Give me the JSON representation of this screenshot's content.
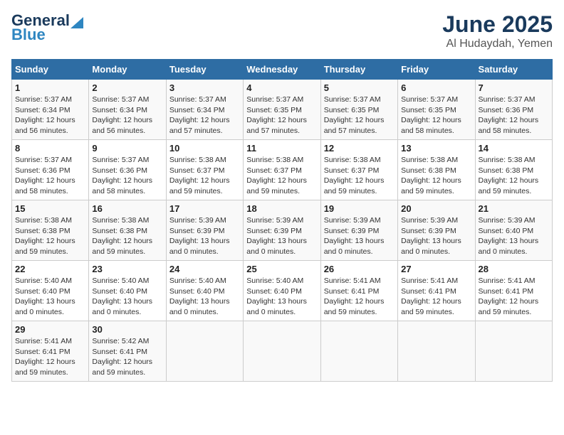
{
  "header": {
    "logo_line1": "General",
    "logo_line2": "Blue",
    "month_title": "June 2025",
    "location": "Al Hudaydah, Yemen"
  },
  "weekdays": [
    "Sunday",
    "Monday",
    "Tuesday",
    "Wednesday",
    "Thursday",
    "Friday",
    "Saturday"
  ],
  "weeks": [
    [
      {
        "day": "1",
        "info": "Sunrise: 5:37 AM\nSunset: 6:34 PM\nDaylight: 12 hours\nand 56 minutes."
      },
      {
        "day": "2",
        "info": "Sunrise: 5:37 AM\nSunset: 6:34 PM\nDaylight: 12 hours\nand 56 minutes."
      },
      {
        "day": "3",
        "info": "Sunrise: 5:37 AM\nSunset: 6:34 PM\nDaylight: 12 hours\nand 57 minutes."
      },
      {
        "day": "4",
        "info": "Sunrise: 5:37 AM\nSunset: 6:35 PM\nDaylight: 12 hours\nand 57 minutes."
      },
      {
        "day": "5",
        "info": "Sunrise: 5:37 AM\nSunset: 6:35 PM\nDaylight: 12 hours\nand 57 minutes."
      },
      {
        "day": "6",
        "info": "Sunrise: 5:37 AM\nSunset: 6:35 PM\nDaylight: 12 hours\nand 58 minutes."
      },
      {
        "day": "7",
        "info": "Sunrise: 5:37 AM\nSunset: 6:36 PM\nDaylight: 12 hours\nand 58 minutes."
      }
    ],
    [
      {
        "day": "8",
        "info": "Sunrise: 5:37 AM\nSunset: 6:36 PM\nDaylight: 12 hours\nand 58 minutes."
      },
      {
        "day": "9",
        "info": "Sunrise: 5:37 AM\nSunset: 6:36 PM\nDaylight: 12 hours\nand 58 minutes."
      },
      {
        "day": "10",
        "info": "Sunrise: 5:38 AM\nSunset: 6:37 PM\nDaylight: 12 hours\nand 59 minutes."
      },
      {
        "day": "11",
        "info": "Sunrise: 5:38 AM\nSunset: 6:37 PM\nDaylight: 12 hours\nand 59 minutes."
      },
      {
        "day": "12",
        "info": "Sunrise: 5:38 AM\nSunset: 6:37 PM\nDaylight: 12 hours\nand 59 minutes."
      },
      {
        "day": "13",
        "info": "Sunrise: 5:38 AM\nSunset: 6:38 PM\nDaylight: 12 hours\nand 59 minutes."
      },
      {
        "day": "14",
        "info": "Sunrise: 5:38 AM\nSunset: 6:38 PM\nDaylight: 12 hours\nand 59 minutes."
      }
    ],
    [
      {
        "day": "15",
        "info": "Sunrise: 5:38 AM\nSunset: 6:38 PM\nDaylight: 12 hours\nand 59 minutes."
      },
      {
        "day": "16",
        "info": "Sunrise: 5:38 AM\nSunset: 6:38 PM\nDaylight: 12 hours\nand 59 minutes."
      },
      {
        "day": "17",
        "info": "Sunrise: 5:39 AM\nSunset: 6:39 PM\nDaylight: 13 hours\nand 0 minutes."
      },
      {
        "day": "18",
        "info": "Sunrise: 5:39 AM\nSunset: 6:39 PM\nDaylight: 13 hours\nand 0 minutes."
      },
      {
        "day": "19",
        "info": "Sunrise: 5:39 AM\nSunset: 6:39 PM\nDaylight: 13 hours\nand 0 minutes."
      },
      {
        "day": "20",
        "info": "Sunrise: 5:39 AM\nSunset: 6:39 PM\nDaylight: 13 hours\nand 0 minutes."
      },
      {
        "day": "21",
        "info": "Sunrise: 5:39 AM\nSunset: 6:40 PM\nDaylight: 13 hours\nand 0 minutes."
      }
    ],
    [
      {
        "day": "22",
        "info": "Sunrise: 5:40 AM\nSunset: 6:40 PM\nDaylight: 13 hours\nand 0 minutes."
      },
      {
        "day": "23",
        "info": "Sunrise: 5:40 AM\nSunset: 6:40 PM\nDaylight: 13 hours\nand 0 minutes."
      },
      {
        "day": "24",
        "info": "Sunrise: 5:40 AM\nSunset: 6:40 PM\nDaylight: 13 hours\nand 0 minutes."
      },
      {
        "day": "25",
        "info": "Sunrise: 5:40 AM\nSunset: 6:40 PM\nDaylight: 13 hours\nand 0 minutes."
      },
      {
        "day": "26",
        "info": "Sunrise: 5:41 AM\nSunset: 6:41 PM\nDaylight: 12 hours\nand 59 minutes."
      },
      {
        "day": "27",
        "info": "Sunrise: 5:41 AM\nSunset: 6:41 PM\nDaylight: 12 hours\nand 59 minutes."
      },
      {
        "day": "28",
        "info": "Sunrise: 5:41 AM\nSunset: 6:41 PM\nDaylight: 12 hours\nand 59 minutes."
      }
    ],
    [
      {
        "day": "29",
        "info": "Sunrise: 5:41 AM\nSunset: 6:41 PM\nDaylight: 12 hours\nand 59 minutes."
      },
      {
        "day": "30",
        "info": "Sunrise: 5:42 AM\nSunset: 6:41 PM\nDaylight: 12 hours\nand 59 minutes."
      },
      {
        "day": "",
        "info": ""
      },
      {
        "day": "",
        "info": ""
      },
      {
        "day": "",
        "info": ""
      },
      {
        "day": "",
        "info": ""
      },
      {
        "day": "",
        "info": ""
      }
    ]
  ]
}
